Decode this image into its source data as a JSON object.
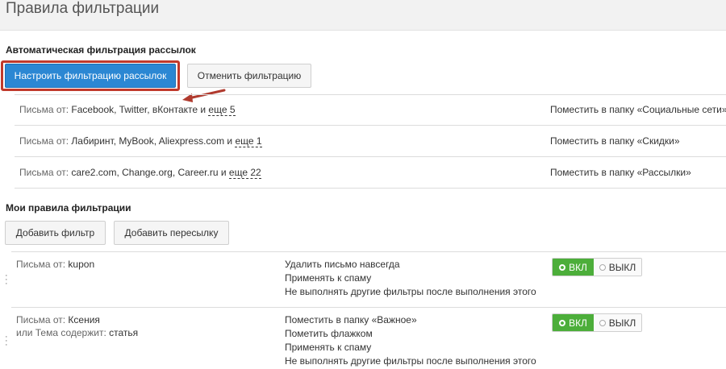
{
  "page": {
    "title": "Правила фильтрации"
  },
  "auto": {
    "title": "Автоматическая фильтрация рассылок",
    "configure_label": "Настроить фильтрацию рассылок",
    "cancel_label": "Отменить фильтрацию",
    "rows": [
      {
        "from_label": "Письма от:",
        "senders": "Facebook, Twitter, вКонтакте и",
        "more": "еще 5",
        "action": "Поместить в папку «Социальные сети»"
      },
      {
        "from_label": "Письма от:",
        "senders": "Лабиринт, MyBook, Aliexpress.com и",
        "more": "еще 1",
        "action": "Поместить в папку «Скидки»"
      },
      {
        "from_label": "Письма от:",
        "senders": "care2.com, Change.org, Career.ru и",
        "more": "еще 22",
        "action": "Поместить в папку «Рассылки»"
      }
    ]
  },
  "my": {
    "title": "Мои правила фильтрации",
    "add_filter_label": "Добавить фильтр",
    "add_forward_label": "Добавить пересылку",
    "rules": [
      {
        "cond1_label": "Письма от:",
        "cond1_value": "kupon",
        "actions": [
          "Удалить письмо навсегда",
          "Применять к спаму",
          "Не выполнять другие фильтры после выполнения этого"
        ],
        "on_label": "ВКЛ",
        "off_label": "ВЫКЛ",
        "enabled": true
      },
      {
        "cond1_label": "Письма от:",
        "cond1_value": "Ксения",
        "cond2_label": "или Тема содержит:",
        "cond2_value": "статья",
        "actions": [
          "Поместить в папку «Важное»",
          "Пометить флажком",
          "Применять к спаму",
          "Не выполнять другие фильтры после выполнения этого"
        ],
        "on_label": "ВКЛ",
        "off_label": "ВЫКЛ",
        "enabled": true
      }
    ]
  },
  "colors": {
    "primary": "#2b87d3",
    "highlight": "#c0392b",
    "toggle_on": "#4cae3a"
  },
  "icons": {
    "annotation_arrow": "arrow-icon",
    "drag": "drag-handle-icon"
  }
}
